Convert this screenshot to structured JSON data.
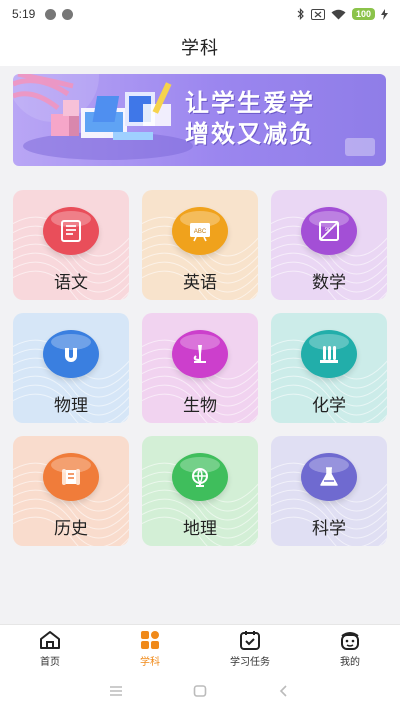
{
  "status_bar": {
    "time": "5:19",
    "battery": "100"
  },
  "header": {
    "title": "学科"
  },
  "banner": {
    "line1": "让学生爱学",
    "line2": "增效又减负"
  },
  "subjects": [
    {
      "label": "语文",
      "icon": "book-icon",
      "bg": "#f8d8dc",
      "accent": "#e94e5a"
    },
    {
      "label": "英语",
      "icon": "abc-board-icon",
      "bg": "#f8e3cc",
      "accent": "#f0a21c"
    },
    {
      "label": "数学",
      "icon": "protractor-icon",
      "bg": "#ead7f4",
      "accent": "#a34fd6"
    },
    {
      "label": "物理",
      "icon": "magnet-icon",
      "bg": "#d6e6f7",
      "accent": "#3a7fe0"
    },
    {
      "label": "生物",
      "icon": "microscope-icon",
      "bg": "#f1d3f0",
      "accent": "#cc3fcc"
    },
    {
      "label": "化学",
      "icon": "test-tubes-icon",
      "bg": "#ccece9",
      "accent": "#22aeaa"
    },
    {
      "label": "历史",
      "icon": "scroll-icon",
      "bg": "#f9dccd",
      "accent": "#f07c3a"
    },
    {
      "label": "地理",
      "icon": "globe-icon",
      "bg": "#d3efd6",
      "accent": "#3fbe5c"
    },
    {
      "label": "科学",
      "icon": "flask-icon",
      "bg": "#e0dff3",
      "accent": "#6f6ad0"
    }
  ],
  "tabs": [
    {
      "label": "首页",
      "icon": "home-icon"
    },
    {
      "label": "学科",
      "icon": "grid-icon"
    },
    {
      "label": "学习任务",
      "icon": "calendar-check-icon"
    },
    {
      "label": "我的",
      "icon": "profile-face-icon"
    }
  ],
  "colors": {
    "active": "#f08a1a",
    "banner": "#9b86ef"
  }
}
